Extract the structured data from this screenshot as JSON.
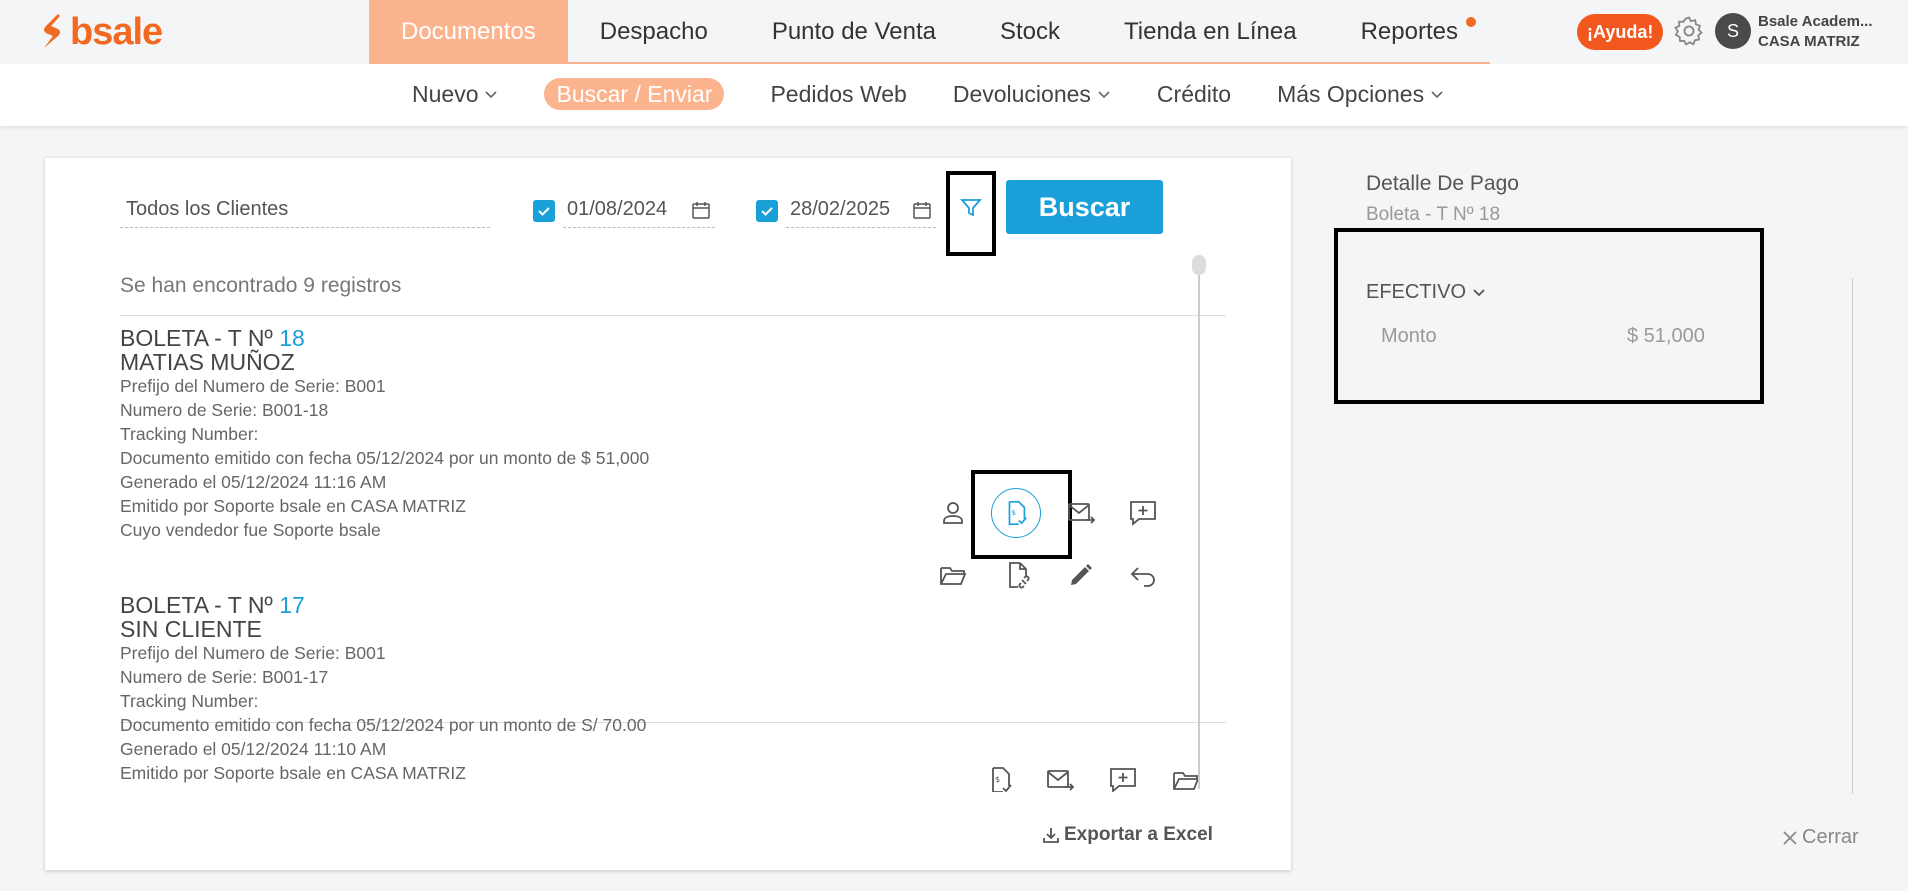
{
  "brand": {
    "logo_text": "bsale",
    "color": "#f26a21"
  },
  "main_nav": [
    {
      "label": "Documentos",
      "active": true
    },
    {
      "label": "Despacho"
    },
    {
      "label": "Punto de Venta"
    },
    {
      "label": "Stock"
    },
    {
      "label": "Tienda en Línea"
    },
    {
      "label": "Reportes",
      "badge": true
    }
  ],
  "help_label": "¡Ayuda!",
  "user": {
    "avatar_initial": "S",
    "name": "Bsale Academ...",
    "branch": "CASA MATRIZ"
  },
  "sub_nav": [
    {
      "label": "Nuevo",
      "dropdown": true
    },
    {
      "label": "Buscar / Enviar",
      "active": true
    },
    {
      "label": "Pedidos Web"
    },
    {
      "label": "Devoluciones",
      "dropdown": true
    },
    {
      "label": "Crédito"
    },
    {
      "label": "Más Opciones",
      "dropdown": true
    }
  ],
  "search": {
    "client_value": "Todos los Clientes",
    "date_from": "01/08/2024",
    "date_to": "28/02/2025",
    "search_button": "Buscar"
  },
  "results_count": "Se han encontrado 9 registros",
  "records": [
    {
      "doc_type": "BOLETA - T Nº",
      "number": "18",
      "client": "MATIAS MUÑOZ",
      "lines": [
        "Prefijo del Numero de Serie: B001",
        "Numero de Serie: B001-18",
        "Tracking Number:",
        "Documento emitido con fecha 05/12/2024 por un monto de $ 51,000",
        "Generado el 05/12/2024 11:16 AM",
        "Emitido por Soporte bsale en CASA MATRIZ",
        "Cuyo vendedor fue Soporte bsale"
      ]
    },
    {
      "doc_type": "BOLETA - T Nº",
      "number": "17",
      "client": "SIN CLIENTE",
      "lines": [
        "Prefijo del Numero de Serie: B001",
        "Numero de Serie: B001-17",
        "Tracking Number:",
        "Documento emitido con fecha 05/12/2024 por un monto de S/ 70.00",
        "Generado el 05/12/2024 11:10 AM",
        "Emitido por Soporte bsale en CASA MATRIZ"
      ]
    }
  ],
  "export_label": "Exportar a Excel",
  "payment_detail": {
    "title": "Detalle De Pago",
    "subtitle": "Boleta - T Nº 18",
    "method": "EFECTIVO",
    "amount_label": "Monto",
    "amount_value": "$ 51,000"
  },
  "close_label": "Cerrar"
}
